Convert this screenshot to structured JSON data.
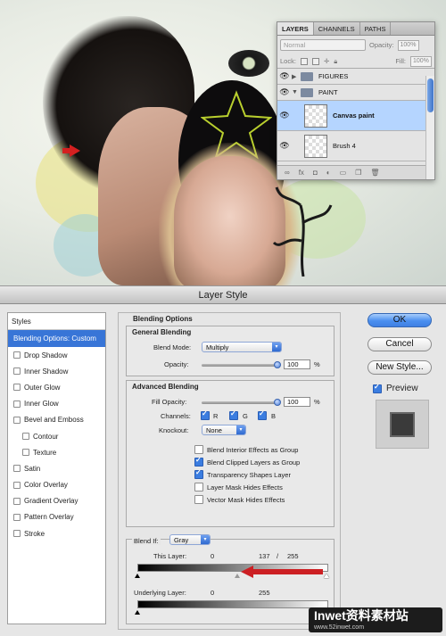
{
  "layers_panel": {
    "tabs": [
      "LAYERS",
      "CHANNELS",
      "PATHS"
    ],
    "blend_mode": "Normal",
    "opacity_label": "Opacity:",
    "opacity_value": "100%",
    "lock_label": "Lock:",
    "fill_label": "Fill:",
    "fill_value": "100%",
    "layers": [
      {
        "name": "FIGURES",
        "type": "group",
        "expanded": false
      },
      {
        "name": "PAINT",
        "type": "group",
        "expanded": true
      },
      {
        "name": "Canvas paint",
        "type": "layer",
        "selected": true
      },
      {
        "name": "Brush 4",
        "type": "layer",
        "selected": false
      }
    ]
  },
  "dialog": {
    "title": "Layer Style",
    "styles_header": "Styles",
    "styles": [
      {
        "label": "Blending Options: Custom",
        "selected": true,
        "has_checkbox": false,
        "indent": false
      },
      {
        "label": "Drop Shadow",
        "checked": false,
        "indent": false
      },
      {
        "label": "Inner Shadow",
        "checked": false,
        "indent": false
      },
      {
        "label": "Outer Glow",
        "checked": false,
        "indent": false
      },
      {
        "label": "Inner Glow",
        "checked": false,
        "indent": false
      },
      {
        "label": "Bevel and Emboss",
        "checked": false,
        "indent": false
      },
      {
        "label": "Contour",
        "checked": false,
        "indent": true
      },
      {
        "label": "Texture",
        "checked": false,
        "indent": true
      },
      {
        "label": "Satin",
        "checked": false,
        "indent": false
      },
      {
        "label": "Color Overlay",
        "checked": false,
        "indent": false
      },
      {
        "label": "Gradient Overlay",
        "checked": false,
        "indent": false
      },
      {
        "label": "Pattern Overlay",
        "checked": false,
        "indent": false
      },
      {
        "label": "Stroke",
        "checked": false,
        "indent": false
      }
    ],
    "blending_options": {
      "title": "Blending Options",
      "general": {
        "title": "General Blending",
        "blend_mode_label": "Blend Mode:",
        "blend_mode": "Multiply",
        "opacity_label": "Opacity:",
        "opacity_value": "100",
        "opacity_unit": "%",
        "opacity_level": 1.0
      },
      "advanced": {
        "title": "Advanced Blending",
        "fill_label": "Fill Opacity:",
        "fill_value": "100",
        "fill_unit": "%",
        "fill_level": 1.0,
        "channels_label": "Channels:",
        "channels": [
          {
            "label": "R",
            "checked": true
          },
          {
            "label": "G",
            "checked": true
          },
          {
            "label": "B",
            "checked": true
          }
        ],
        "knockout_label": "Knockout:",
        "knockout": "None",
        "options": [
          {
            "label": "Blend Interior Effects as Group",
            "checked": false
          },
          {
            "label": "Blend Clipped Layers as Group",
            "checked": true
          },
          {
            "label": "Transparency Shapes Layer",
            "checked": true
          },
          {
            "label": "Layer Mask Hides Effects",
            "checked": false
          },
          {
            "label": "Vector Mask Hides Effects",
            "checked": false
          }
        ]
      },
      "blend_if": {
        "label": "Blend If:",
        "channel": "Gray",
        "this_layer": {
          "label": "This Layer:",
          "low": "0",
          "high_split": "137",
          "separator": "/",
          "high": "255"
        },
        "underlying_layer": {
          "label": "Underlying Layer:",
          "low": "0",
          "high": "255"
        }
      }
    },
    "buttons": {
      "ok": "OK",
      "cancel": "Cancel",
      "new_style": "New Style...",
      "preview_label": "Preview",
      "preview_checked": true
    }
  },
  "watermark": {
    "text": "Inwet资料素材站",
    "url": "www.52inwet.com"
  }
}
